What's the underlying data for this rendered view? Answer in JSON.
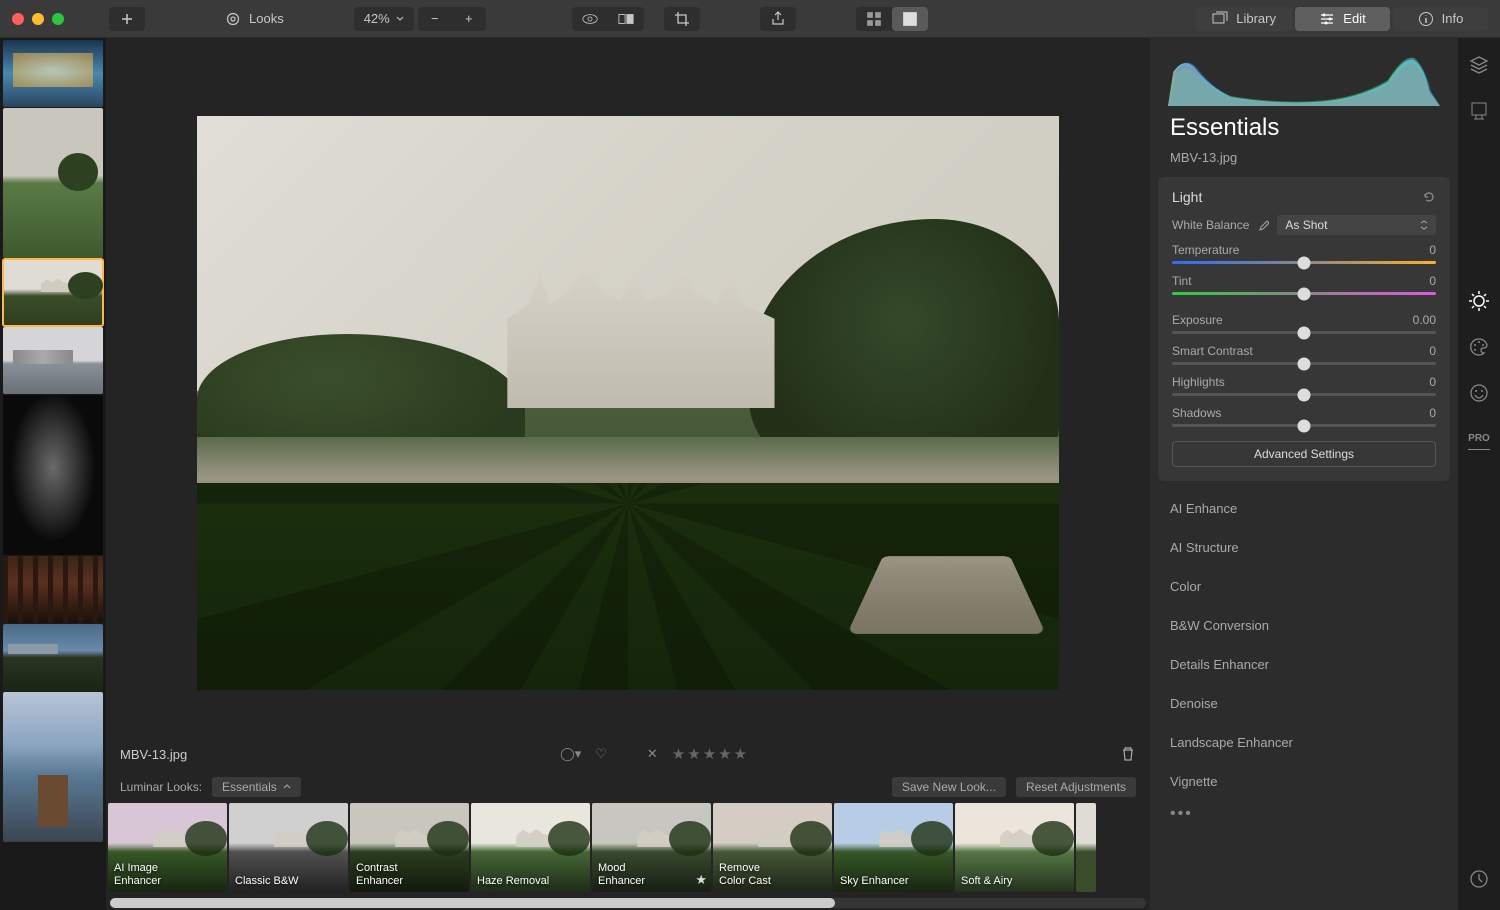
{
  "toolbar": {
    "looks_label": "Looks",
    "zoom_value": "42%",
    "library_label": "Library",
    "edit_label": "Edit",
    "info_label": "Info"
  },
  "filename": "MBV-13.jpg",
  "panel": {
    "title": "Essentials",
    "filename": "MBV-13.jpg",
    "light": {
      "title": "Light",
      "wb_label": "White Balance",
      "wb_value": "As Shot",
      "temperature": {
        "label": "Temperature",
        "value": "0"
      },
      "tint": {
        "label": "Tint",
        "value": "0"
      },
      "exposure": {
        "label": "Exposure",
        "value": "0.00"
      },
      "smart_contrast": {
        "label": "Smart Contrast",
        "value": "0"
      },
      "highlights": {
        "label": "Highlights",
        "value": "0"
      },
      "shadows": {
        "label": "Shadows",
        "value": "0"
      },
      "advanced": "Advanced Settings"
    },
    "sections": [
      "AI Enhance",
      "AI Structure",
      "Color",
      "B&W Conversion",
      "Details Enhancer",
      "Denoise",
      "Landscape Enhancer",
      "Vignette"
    ]
  },
  "looksbar": {
    "label": "Luminar Looks:",
    "category": "Essentials",
    "save": "Save New Look...",
    "reset": "Reset Adjustments",
    "items": [
      "AI Image\nEnhancer",
      "Classic B&W",
      "Contrast\nEnhancer",
      "Haze Removal",
      "Mood\nEnhancer",
      "Remove\nColor Cast",
      "Sky Enhancer",
      "Soft & Airy"
    ]
  }
}
